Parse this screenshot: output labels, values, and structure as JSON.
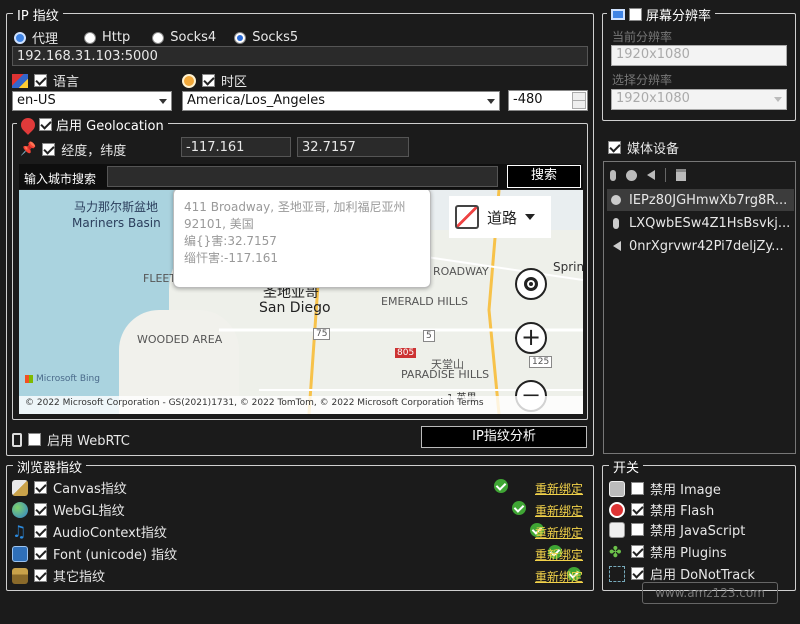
{
  "ip_section": {
    "title": "IP 指纹",
    "proxy_options": [
      {
        "label": "代理",
        "selected": false
      },
      {
        "label": "Http",
        "selected": false
      },
      {
        "label": "Socks4",
        "selected": false
      },
      {
        "label": "Socks5",
        "selected": true
      }
    ],
    "proxy_address": "192.168.31.103:5000",
    "language_label": "语言",
    "timezone_label": "时区",
    "language_value": "en-US",
    "timezone_value": "America/Los_Angeles",
    "offset_value": "-480",
    "geolocation_label": "启用 Geolocation",
    "latlng_label": "经度，纬度",
    "longitude": "-117.161",
    "latitude": "32.7157",
    "city_search_label": "输入城市搜索",
    "city_search_value": "",
    "search_button": "搜索",
    "webrtc_label": "启用 WebRTC",
    "ip_analysis_button": "IP指纹分析"
  },
  "map": {
    "popup_address": "411 Broadway, 圣地亚哥, 加利福尼亚州 92101, 美国",
    "popup_lat": "编{}害:32.7157",
    "popup_lng": "缁忓害:-117.161",
    "layer_label": "道路",
    "labels": {
      "basin_cn": "马力那尔斯盆地",
      "basin_en": "Mariners Basin",
      "city_cn": "圣地亚哥",
      "city_en": "San Diego",
      "fleet": "FLEET",
      "wooded": "WOODED AREA",
      "emerald": "EMERALD HILLS",
      "roadway": "ROADWAY",
      "spring": "Spring Valle",
      "paradise_cn": "天堂山",
      "paradise": "PARADISE HILLS",
      "scale": "1 英里",
      "brand": "Microsoft Bing",
      "copyright": "© 2022 Microsoft Corporation - GS(2021)1731, © 2022 TomTom, © 2022 Microsoft Corporation  Terms",
      "hwy_75": "75",
      "hwy_805": "805",
      "hwy_125": "125",
      "hwy_5": "5"
    }
  },
  "browser_section": {
    "title": "浏览器指纹",
    "rebind_label": "重新绑定",
    "items": [
      {
        "label": "Canvas指纹"
      },
      {
        "label": "WebGL指纹"
      },
      {
        "label": "AudioContext指纹"
      },
      {
        "label": "Font (unicode) 指纹"
      },
      {
        "label": "其它指纹"
      }
    ]
  },
  "resolution_section": {
    "title": "屏幕分辨率",
    "current_label": "当前分辨率",
    "current_value": "1920x1080",
    "select_label": "选择分辨率",
    "select_value": "1920x1080"
  },
  "media_section": {
    "title": "媒体设备",
    "items": [
      {
        "name": "IEPz80JGHmwXb7rg8R...",
        "kind": "camera"
      },
      {
        "name": "LXQwbESw4Z1HsBsvkj...",
        "kind": "mic"
      },
      {
        "name": "0nrXgrvwr42Pi7deljZy...",
        "kind": "speaker"
      }
    ]
  },
  "switch_section": {
    "title": "开关",
    "items": [
      {
        "label": "禁用 Image",
        "checked": false
      },
      {
        "label": "禁用 Flash",
        "checked": true
      },
      {
        "label": "禁用 JavaScript",
        "checked": false
      },
      {
        "label": "禁用 Plugins",
        "checked": true
      },
      {
        "label": "启用 DoNotTrack",
        "checked": true
      }
    ]
  },
  "watermark": "www.amz123.com",
  "colors": {
    "background": "#1b1b1b",
    "accent_link": "#f2d24a",
    "ok_green": "#3fa534",
    "selected_row": "#3c3c3c"
  }
}
